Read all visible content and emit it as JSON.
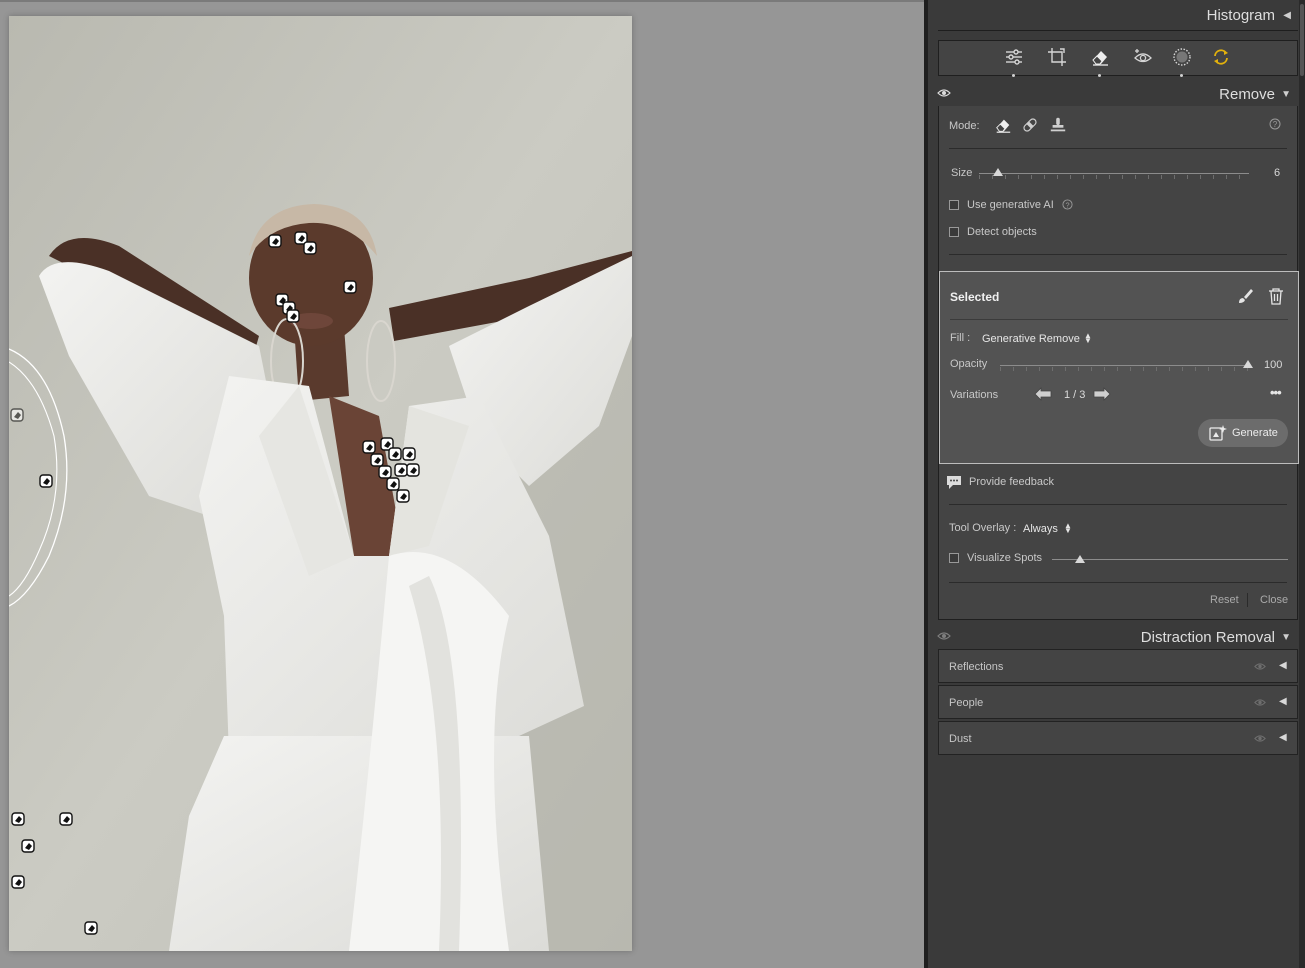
{
  "histogram": {
    "title": "Histogram"
  },
  "tools": [
    "edit-sliders-icon",
    "crop-icon",
    "remove-eraser-icon",
    "red-eye-icon",
    "masking-icon",
    "presets-sync-icon"
  ],
  "remove": {
    "title": "Remove",
    "mode_label": "Mode:",
    "size_label": "Size",
    "size_value": "6",
    "size_fraction": 0.07,
    "use_gen_ai_label": "Use generative AI",
    "detect_objects_label": "Detect objects",
    "selected": {
      "title": "Selected",
      "fill_label": "Fill :",
      "fill_value": "Generative Remove",
      "opacity_label": "Opacity",
      "opacity_value": "100",
      "opacity_fraction": 1.0,
      "variations_label": "Variations",
      "variations_value": "1 / 3",
      "generate_label": "Generate"
    },
    "feedback_label": "Provide feedback",
    "tool_overlay_label": "Tool Overlay :",
    "tool_overlay_value": "Always",
    "visualize_spots_label": "Visualize Spots",
    "visualize_spots_fraction": 0.12,
    "reset_label": "Reset",
    "close_label": "Close"
  },
  "distraction": {
    "title": "Distraction Removal",
    "rows": [
      {
        "label": "Reflections"
      },
      {
        "label": "People"
      },
      {
        "label": "Dust"
      }
    ]
  }
}
